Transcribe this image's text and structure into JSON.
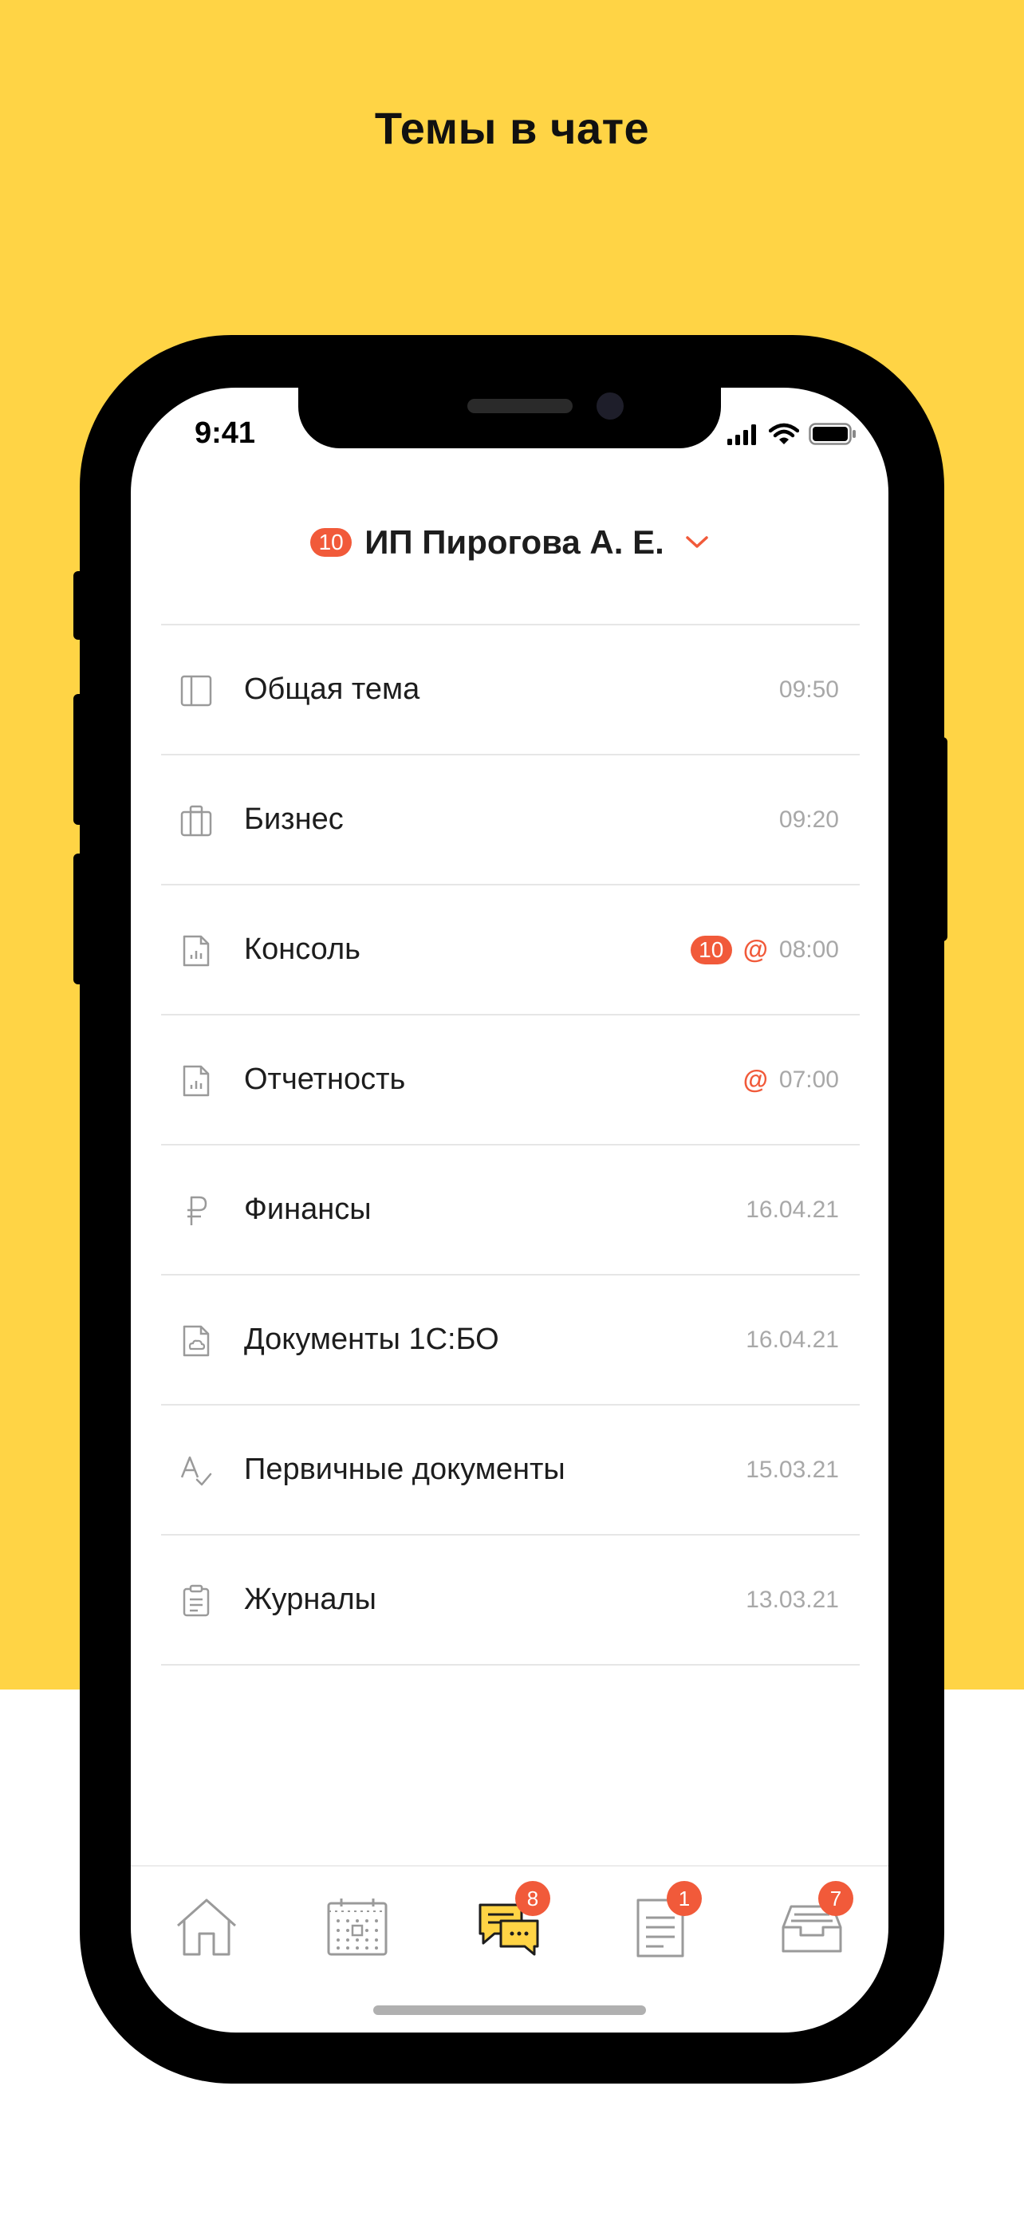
{
  "promo": {
    "headline": "Темы в чате",
    "background_color": "#FFD445"
  },
  "status_bar": {
    "time": "9:41",
    "icons": [
      "cellular-signal-icon",
      "wifi-icon",
      "battery-icon"
    ]
  },
  "chat": {
    "unread_count": "10",
    "title": "ИП Пирогова А. Е.",
    "accent_color": "#F15A3A"
  },
  "topics": [
    {
      "name": "Общая тема",
      "time": "09:50",
      "icon": "sidebar-layout-icon"
    },
    {
      "name": "Бизнес",
      "time": "09:20",
      "icon": "briefcase-icon"
    },
    {
      "name": "Консоль",
      "time": "08:00",
      "icon": "report-file-icon",
      "unread": "10",
      "mention": "@"
    },
    {
      "name": "Отчетность",
      "time": "07:00",
      "icon": "report-file-icon",
      "mention": "@"
    },
    {
      "name": "Финансы",
      "time": "16.04.21",
      "icon": "ruble-icon"
    },
    {
      "name": "Документы 1С:БО",
      "time": "16.04.21",
      "icon": "cloud-document-icon"
    },
    {
      "name": "Первичные документы",
      "time": "15.03.21",
      "icon": "text-check-icon"
    },
    {
      "name": "Журналы",
      "time": "13.03.21",
      "icon": "clipboard-icon"
    }
  ],
  "tab_bar": {
    "tabs": [
      {
        "name": "home",
        "icon": "home-icon"
      },
      {
        "name": "calendar",
        "icon": "calendar-icon"
      },
      {
        "name": "chats",
        "icon": "chat-bubbles-icon",
        "badge": "8",
        "active": true
      },
      {
        "name": "documents",
        "icon": "document-icon",
        "badge": "1"
      },
      {
        "name": "archive",
        "icon": "inbox-tray-icon",
        "badge": "7"
      }
    ]
  }
}
